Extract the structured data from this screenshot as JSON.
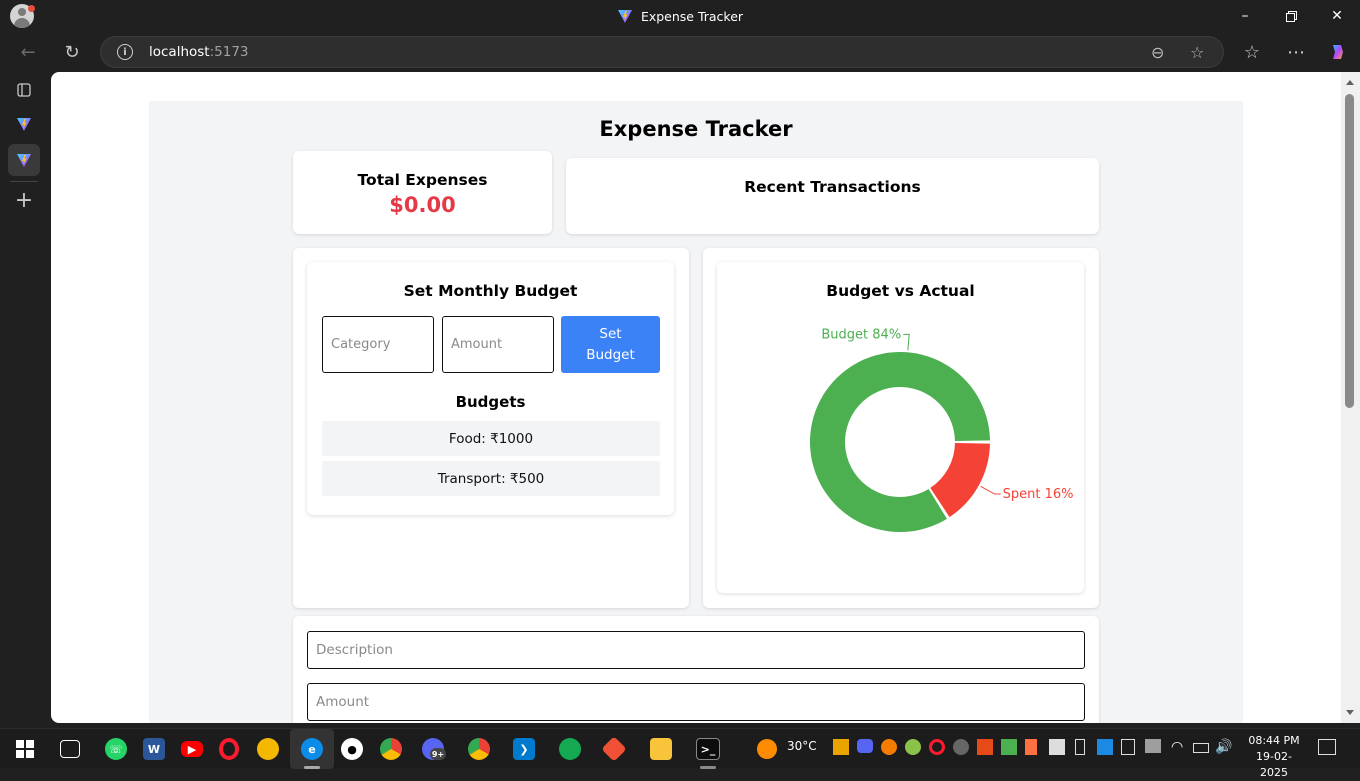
{
  "window": {
    "title": "Expense Tracker"
  },
  "browser": {
    "url_host": "localhost",
    "url_port": ":5173"
  },
  "app": {
    "title": "Expense Tracker",
    "total": {
      "label": "Total Expenses",
      "value": "$0.00",
      "color": "#e53946"
    },
    "recent": {
      "label": "Recent Transactions"
    },
    "budget_form": {
      "heading": "Set Monthly Budget",
      "category_placeholder": "Category",
      "amount_placeholder": "Amount",
      "button_line1": "Set",
      "button_line2": "Budget",
      "button_color": "#3b82f6"
    },
    "budgets": {
      "heading": "Budgets",
      "items": [
        {
          "text": "Food: ₹1000"
        },
        {
          "text": "Transport: ₹500"
        }
      ]
    },
    "chart": {
      "heading": "Budget vs Actual"
    },
    "expense_form": {
      "description_placeholder": "Description",
      "amount_placeholder": "Amount"
    }
  },
  "chart_data": {
    "type": "pie",
    "title": "Budget vs Actual",
    "categories": [
      "Budget",
      "Spent"
    ],
    "values": [
      84,
      16
    ],
    "labels": [
      "Budget 84%",
      "Spent 16%"
    ],
    "colors": [
      "#4caf50",
      "#f44336"
    ],
    "donut": true
  },
  "taskbar": {
    "weather": "30°C",
    "time": "08:44 PM",
    "date": "19-02-2025",
    "badge": "9+"
  }
}
